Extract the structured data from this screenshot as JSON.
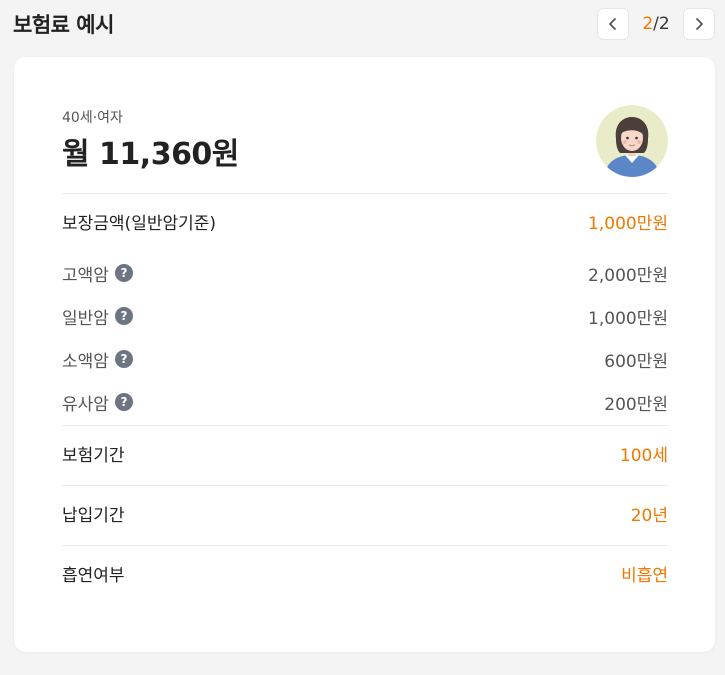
{
  "header": {
    "title": "보험료 예시",
    "pager_current": "2",
    "pager_total": "/2",
    "prev_icon": "chevron-left-icon",
    "next_icon": "chevron-right-icon"
  },
  "profile": {
    "age_gender": "40세·여자",
    "premium": "월 11,360원",
    "avatar_icon": "woman-avatar-icon"
  },
  "coverage": {
    "label": "보장금액(일반암기준)",
    "value": "1,000만원",
    "help_glyph": "?",
    "items": [
      {
        "label": "고액암",
        "value": "2,000만원"
      },
      {
        "label": "일반암",
        "value": "1,000만원"
      },
      {
        "label": "소액암",
        "value": "600만원"
      },
      {
        "label": "유사암",
        "value": "200만원"
      }
    ]
  },
  "terms": [
    {
      "label": "보험기간",
      "value": "100세"
    },
    {
      "label": "납입기간",
      "value": "20년"
    },
    {
      "label": "흡연여부",
      "value": "비흡연"
    }
  ],
  "colors": {
    "accent": "#f07800",
    "background": "#f4f4f4",
    "card": "#ffffff",
    "help_badge": "#6e7582"
  }
}
